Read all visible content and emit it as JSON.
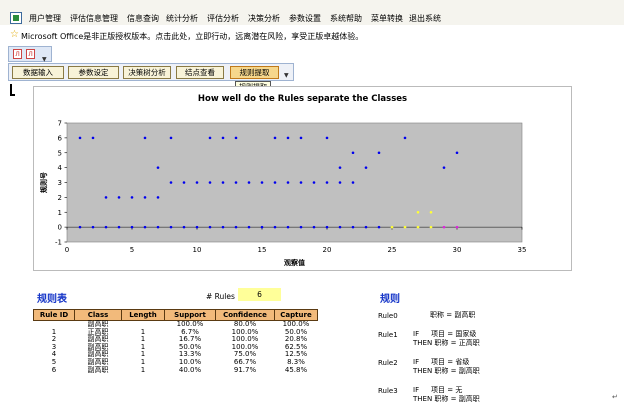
{
  "menu": {
    "items": [
      "用户管理",
      "评估信息管理",
      "信息查询",
      "统计分析",
      "评估分析",
      "决策分析",
      "参数设置",
      "系统帮助",
      "菜单转换",
      "退出系统"
    ]
  },
  "notice": {
    "text": "Microsoft Office是非正版授权版本。点击此处，立即行动，远离潜在风险，享受正版卓越体验。"
  },
  "buttons": [
    "数据输入",
    "参数设定",
    "决策树分析",
    "结点查看",
    "规则提取"
  ],
  "tooltip": "规则提取",
  "chart_data": {
    "type": "scatter",
    "title": "How well do the Rules separate the Classes",
    "xlabel": "观察值",
    "ylabel": "规则号",
    "xlim": [
      0,
      35
    ],
    "ylim": [
      -1,
      7
    ],
    "xticks": [
      0,
      5,
      10,
      15,
      20,
      25,
      30,
      35
    ],
    "yticks": [
      -1,
      0,
      1,
      2,
      3,
      4,
      5,
      6,
      7
    ],
    "plot_background": "#c0c0c0",
    "series": [
      {
        "color": "#0000ee",
        "points": [
          [
            1,
            6
          ],
          [
            2,
            6
          ],
          [
            6,
            6
          ],
          [
            8,
            6
          ],
          [
            11,
            6
          ],
          [
            12,
            6
          ],
          [
            13,
            6
          ],
          [
            16,
            6
          ],
          [
            17,
            6
          ],
          [
            18,
            6
          ],
          [
            20,
            6
          ],
          [
            26,
            6
          ],
          [
            22,
            5
          ],
          [
            24,
            5
          ],
          [
            30,
            5
          ],
          [
            7,
            4
          ],
          [
            21,
            4
          ],
          [
            23,
            4
          ],
          [
            29,
            4
          ],
          [
            8,
            3
          ],
          [
            9,
            3
          ],
          [
            10,
            3
          ],
          [
            11,
            3
          ],
          [
            12,
            3
          ],
          [
            13,
            3
          ],
          [
            14,
            3
          ],
          [
            15,
            3
          ],
          [
            16,
            3
          ],
          [
            17,
            3
          ],
          [
            18,
            3
          ],
          [
            19,
            3
          ],
          [
            20,
            3
          ],
          [
            21,
            3
          ],
          [
            22,
            3
          ],
          [
            3,
            2
          ],
          [
            4,
            2
          ],
          [
            5,
            2
          ],
          [
            6,
            2
          ],
          [
            7,
            2
          ],
          [
            1,
            0
          ],
          [
            2,
            0
          ],
          [
            3,
            0
          ],
          [
            4,
            0
          ],
          [
            5,
            0
          ],
          [
            6,
            0
          ],
          [
            7,
            0
          ],
          [
            8,
            0
          ],
          [
            9,
            0
          ],
          [
            10,
            0
          ],
          [
            11,
            0
          ],
          [
            12,
            0
          ],
          [
            13,
            0
          ],
          [
            14,
            0
          ],
          [
            15,
            0
          ],
          [
            16,
            0
          ],
          [
            17,
            0
          ],
          [
            18,
            0
          ],
          [
            19,
            0
          ],
          [
            20,
            0
          ],
          [
            21,
            0
          ],
          [
            22,
            0
          ],
          [
            23,
            0
          ],
          [
            24,
            0
          ]
        ]
      },
      {
        "color": "#ffff33",
        "points": [
          [
            27,
            1
          ],
          [
            28,
            1
          ],
          [
            25,
            0
          ],
          [
            26,
            0
          ],
          [
            27,
            0
          ],
          [
            28,
            0
          ]
        ]
      },
      {
        "color": "#dd22dd",
        "points": [
          [
            29,
            0
          ],
          [
            30,
            0
          ]
        ]
      }
    ]
  },
  "rule_table": {
    "title": "规则表",
    "rules_label": "# Rules",
    "rules_count": "6",
    "headers": [
      "Rule ID",
      "Class",
      "Length",
      "Support",
      "Confidence",
      "Capture"
    ],
    "rows": [
      [
        "",
        "副高职",
        "",
        "100.0%",
        "80.0%",
        "100.0%"
      ],
      [
        "1",
        "正高职",
        "1",
        "6.7%",
        "100.0%",
        "50.0%"
      ],
      [
        "2",
        "副高职",
        "1",
        "16.7%",
        "100.0%",
        "20.8%"
      ],
      [
        "3",
        "副高职",
        "1",
        "50.0%",
        "100.0%",
        "62.5%"
      ],
      [
        "4",
        "副高职",
        "1",
        "13.3%",
        "75.0%",
        "12.5%"
      ],
      [
        "5",
        "副高职",
        "1",
        "10.0%",
        "66.7%",
        "8.3%"
      ],
      [
        "6",
        "副高职",
        "1",
        "40.0%",
        "91.7%",
        "45.8%"
      ]
    ]
  },
  "rules_text": {
    "title": "规则",
    "rule0": {
      "name": "Rule0",
      "then": "职称 = 副高职"
    },
    "rule1": {
      "name": "Rule1",
      "if_kw": "IF",
      "if_text": "项目 = 国家级",
      "then": "THEN 职称 = 正高职"
    },
    "rule2": {
      "name": "Rule2",
      "if_kw": "IF",
      "if_text": "项目 = 省级",
      "then": "THEN 职称 = 副高职"
    },
    "rule3": {
      "name": "Rule3",
      "if_kw": "IF",
      "if_text": "项目 = 无",
      "then": "THEN 职称 = 副高职"
    }
  }
}
